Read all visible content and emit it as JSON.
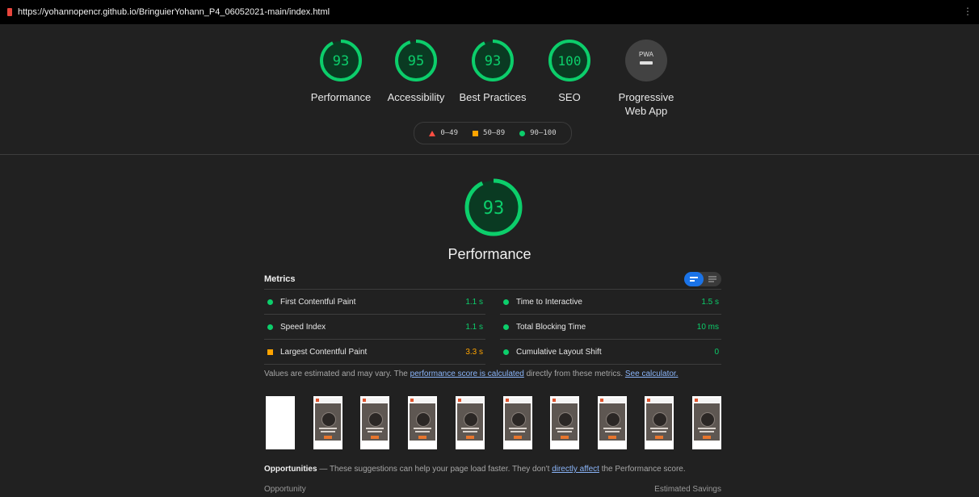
{
  "browser": {
    "url": "https://yohannopencr.github.io/BringuierYohann_P4_06052021-main/index.html",
    "menu_icon": "more-vert-icon"
  },
  "colors": {
    "pass": "#0cce6b",
    "average": "#ffa400",
    "fail": "#ff4e42",
    "accent": "#1a73e8",
    "link": "#8ab4f8"
  },
  "gauges": [
    {
      "score": 93,
      "score_text": "93",
      "label": "Performance"
    },
    {
      "score": 95,
      "score_text": "95",
      "label": "Accessibility"
    },
    {
      "score": 93,
      "score_text": "93",
      "label": "Best Practices"
    },
    {
      "score": 100,
      "score_text": "100",
      "label": "SEO"
    },
    {
      "badge": "PWA",
      "label_line1": "Progressive",
      "label_line2": "Web App"
    }
  ],
  "legend": {
    "fail": "0–49",
    "average": "50–89",
    "pass": "90–100"
  },
  "performance": {
    "score": 93,
    "score_text": "93",
    "title": "Performance"
  },
  "metrics": {
    "title": "Metrics",
    "left": [
      {
        "name": "First Contentful Paint",
        "value": "1.1 s",
        "status": "pass"
      },
      {
        "name": "Speed Index",
        "value": "1.1 s",
        "status": "pass"
      },
      {
        "name": "Largest Contentful Paint",
        "value": "3.3 s",
        "status": "average"
      }
    ],
    "right": [
      {
        "name": "Time to Interactive",
        "value": "1.5 s",
        "status": "pass"
      },
      {
        "name": "Total Blocking Time",
        "value": "10 ms",
        "status": "pass"
      },
      {
        "name": "Cumulative Layout Shift",
        "value": "0",
        "status": "pass"
      }
    ]
  },
  "note": {
    "prefix": "Values are estimated and may vary. The ",
    "link1": "performance score is calculated",
    "middle": " directly from these metrics. ",
    "link2": "See calculator."
  },
  "opportunities": {
    "title": "Opportunities",
    "text": " — These suggestions can help your page load faster. They don't ",
    "link": "directly affect",
    "suffix": " the Performance score.",
    "col_left": "Opportunity",
    "col_right": "Estimated Savings"
  }
}
